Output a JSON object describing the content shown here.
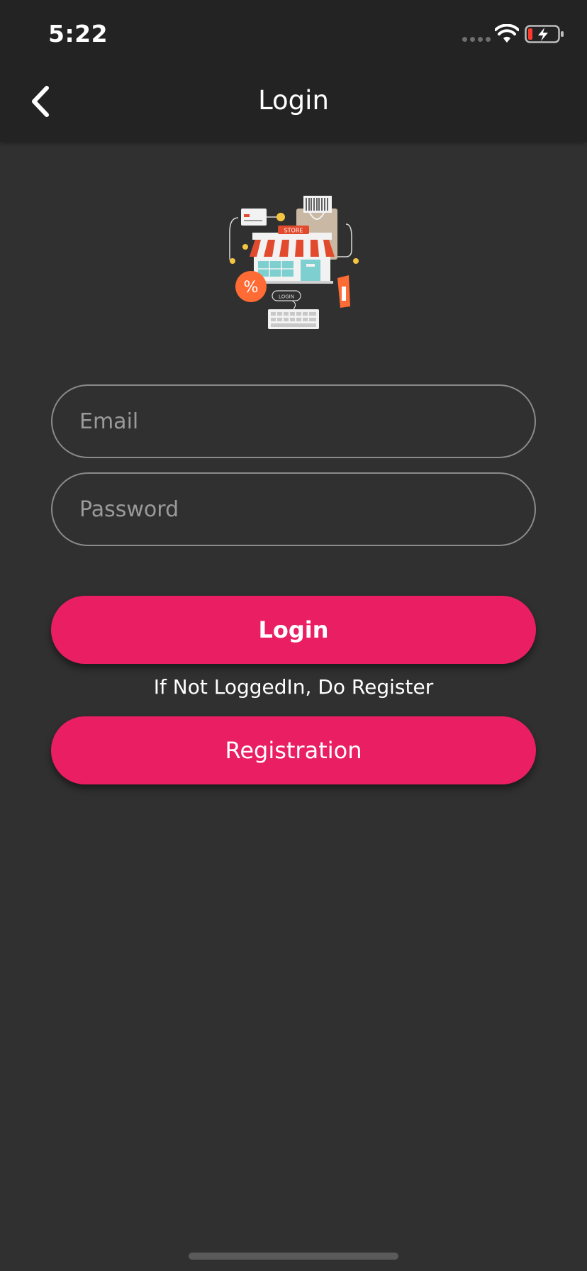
{
  "status_bar": {
    "time": "5:22",
    "icons": [
      "signal-icon",
      "wifi-icon",
      "battery-charging-icon"
    ]
  },
  "header": {
    "title": "Login",
    "back_icon": "chevron-left-icon"
  },
  "logo": {
    "name": "store-illustration",
    "store_sign": "STORE",
    "login_tag": "LOGIN"
  },
  "form": {
    "email_placeholder": "Email",
    "password_placeholder": "Password"
  },
  "buttons": {
    "login_label": "Login",
    "register_hint": "If Not LoggedIn, Do Register",
    "registration_label": "Registration"
  },
  "colors": {
    "accent": "#e91e63",
    "background": "#303030",
    "header": "#232323",
    "field_border": "#8a8a8a"
  }
}
